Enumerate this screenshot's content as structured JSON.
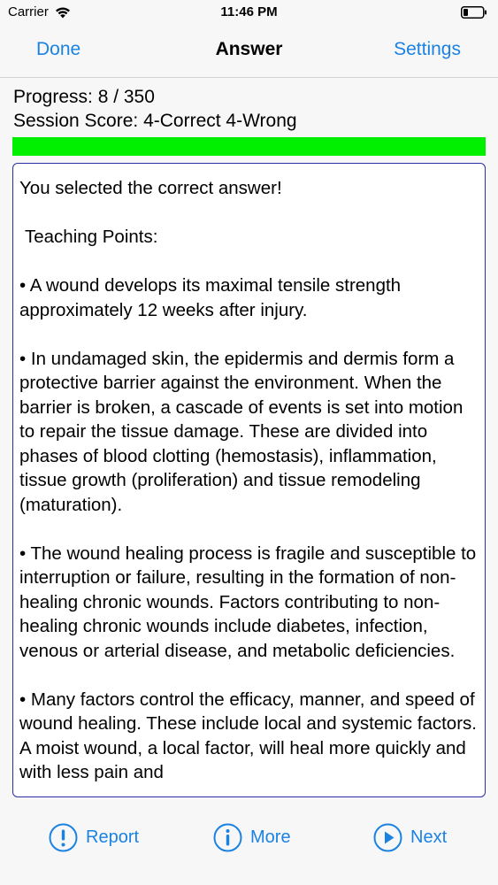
{
  "status_bar": {
    "carrier": "Carrier",
    "time": "11:46 PM"
  },
  "nav": {
    "done_label": "Done",
    "title": "Answer",
    "settings_label": "Settings"
  },
  "session": {
    "progress_text": "Progress: 8 / 350",
    "score_text": "Session Score: 4-Correct 4-Wrong",
    "bar_fill_fraction": 1.0,
    "bar_color": "#00f000"
  },
  "answer": {
    "result": "You selected the correct answer!",
    "teaching_heading": "Teaching Points:",
    "points": [
      "• A wound develops its maximal tensile strength approximately 12 weeks after injury.",
      "• In undamaged skin, the epidermis and dermis form a protective barrier against the environment. When the barrier is broken, a cascade of events is set into motion to repair the tissue damage. These are divided into phases of blood clotting (hemostasis), inflammation, tissue growth (proliferation) and tissue remodeling (maturation).",
      "• The wound healing process is fragile and susceptible to interruption or failure, resulting in the formation of non-healing chronic wounds. Factors contributing to non-healing chronic wounds include diabetes, infection, venous or arterial disease, and metabolic deficiencies.",
      "• Many factors control the efficacy, manner, and speed of wound healing. These include local and systemic factors. A moist wound, a local factor, will heal more quickly and with less pain and"
    ]
  },
  "toolbar": {
    "report_label": "Report",
    "more_label": "More",
    "next_label": "Next"
  },
  "icons": {
    "report": "exclamation-circle-icon",
    "more": "info-circle-icon",
    "next": "play-circle-icon"
  },
  "colors": {
    "accent": "#1a82e2",
    "box_border": "#2b2fa6"
  }
}
